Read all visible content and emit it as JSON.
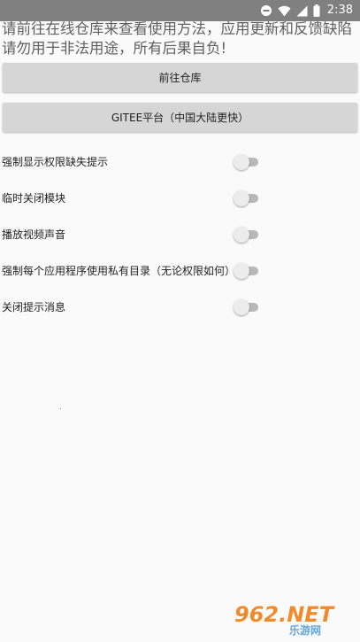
{
  "status_bar": {
    "time": "2:38",
    "icons": [
      "do-not-disturb-icon",
      "wifi-icon",
      "signal-icon",
      "battery-icon"
    ]
  },
  "notice": {
    "line1": "请前往在线仓库来查看使用方法，应用更新和反馈缺陷",
    "line2": "请勿用于非法用途，所有后果自负!"
  },
  "buttons": {
    "warehouse_label": "前往仓库",
    "gitee_label": "GITEE平台（中国大陆更快）"
  },
  "settings": [
    {
      "label": "强制显示权限缺失提示",
      "enabled": false
    },
    {
      "label": "临时关闭模块",
      "enabled": false
    },
    {
      "label": "播放视频声音",
      "enabled": false
    },
    {
      "label": "强制每个应用程序使用私有目录（无论权限如何）",
      "enabled": false
    },
    {
      "label": "关闭提示消息",
      "enabled": false
    }
  ],
  "watermark": {
    "main": "962.NET",
    "sub": "乐游网"
  },
  "colors": {
    "status_bar": "#808080",
    "button": "#d6d6d6",
    "background": "#fafafa",
    "switch_track_off": "#b8b8b8",
    "switch_thumb_off": "#ececec"
  }
}
